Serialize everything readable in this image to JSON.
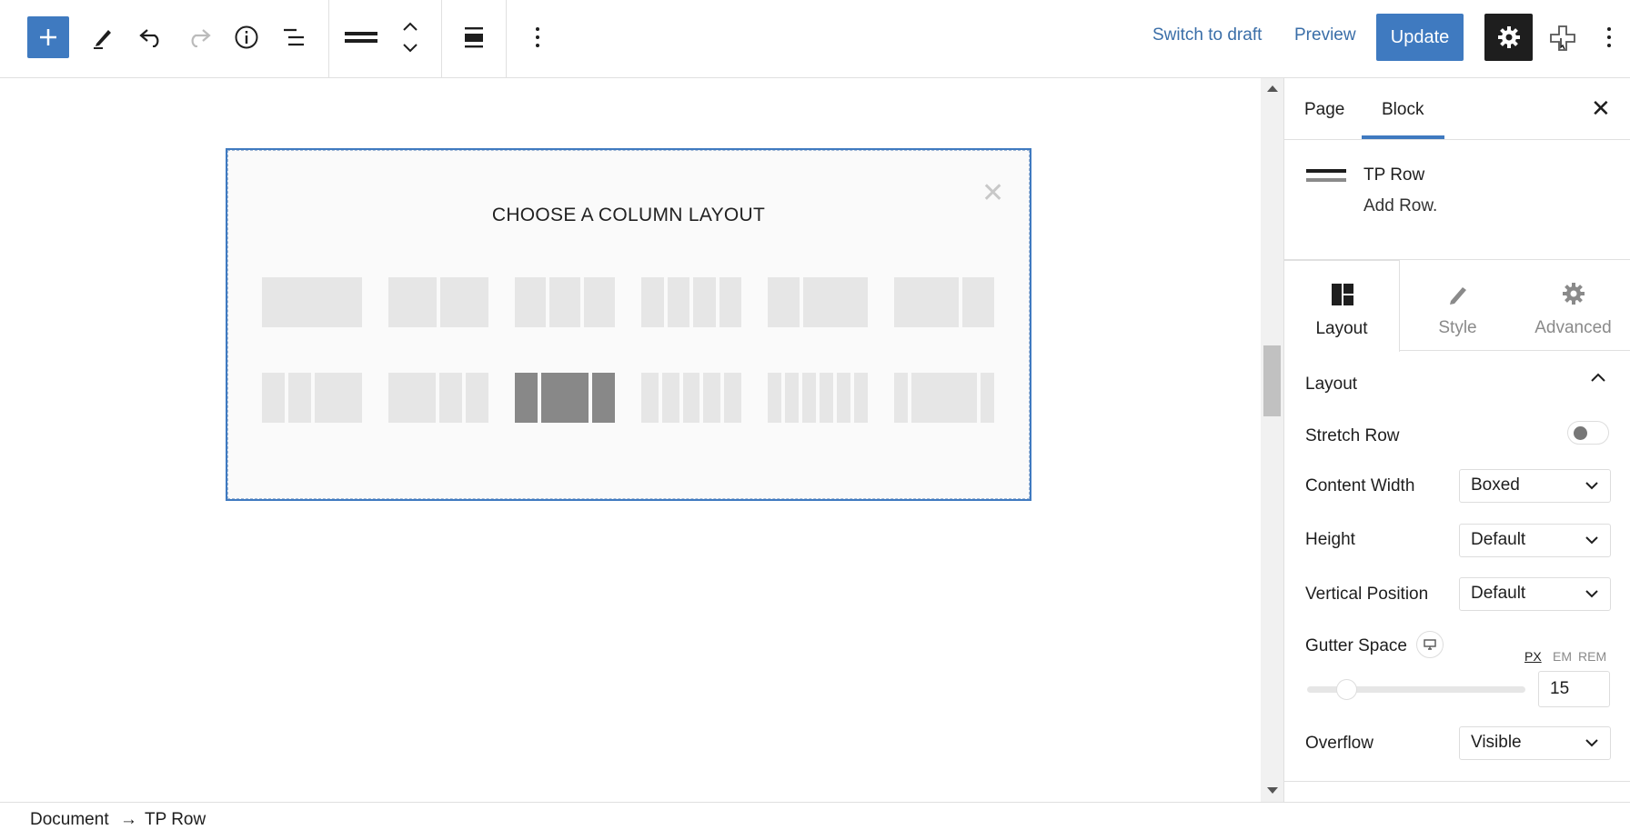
{
  "toolbar": {
    "add_icon": "plus-icon",
    "edit_icon": "pencil-icon",
    "undo_icon": "undo-icon",
    "redo_icon": "redo-icon",
    "info_icon": "info-icon",
    "list_view_icon": "list-view-icon",
    "block_type_icon": "row-icon",
    "move_icon": "up-down-chevron-icon",
    "align_icon": "align-icon",
    "more_icon": "vertical-ellipsis-icon",
    "switch_to_draft": "Switch to draft",
    "preview": "Preview",
    "update": "Update",
    "settings_icon": "gear-icon",
    "plugin_icon": "plugin-icon",
    "options_icon": "vertical-ellipsis-icon"
  },
  "canvas": {
    "layout_title": "CHOOSE A COLUMN LAYOUT",
    "close_label": "✕",
    "selected_layout_index": 8,
    "accent_color": "#3f7ac0"
  },
  "breadcrumb": {
    "root": "Document",
    "separator": "→",
    "current": "TP Row"
  },
  "sidebar": {
    "tabs": [
      {
        "label": "Page",
        "active": false
      },
      {
        "label": "Block",
        "active": true
      }
    ],
    "close_label": "✕",
    "block": {
      "icon": "row-icon",
      "name": "TP Row",
      "description": "Add Row."
    },
    "sub_tabs": [
      {
        "label": "Layout",
        "icon": "layout-icon",
        "active": true
      },
      {
        "label": "Style",
        "icon": "brush-icon",
        "active": false
      },
      {
        "label": "Advanced",
        "icon": "gear-icon",
        "active": false
      }
    ],
    "section": {
      "title": "Layout",
      "expanded": true
    },
    "fields": {
      "stretch_row": {
        "label": "Stretch Row",
        "value": false
      },
      "content_width": {
        "label": "Content Width",
        "value": "Boxed"
      },
      "height": {
        "label": "Height",
        "value": "Default"
      },
      "vertical_position": {
        "label": "Vertical Position",
        "value": "Default"
      },
      "gutter_space": {
        "label": "Gutter Space",
        "units": [
          "PX",
          "EM",
          "REM"
        ],
        "active_unit": "PX",
        "value": "15"
      },
      "overflow": {
        "label": "Overflow",
        "value": "Visible"
      }
    }
  }
}
